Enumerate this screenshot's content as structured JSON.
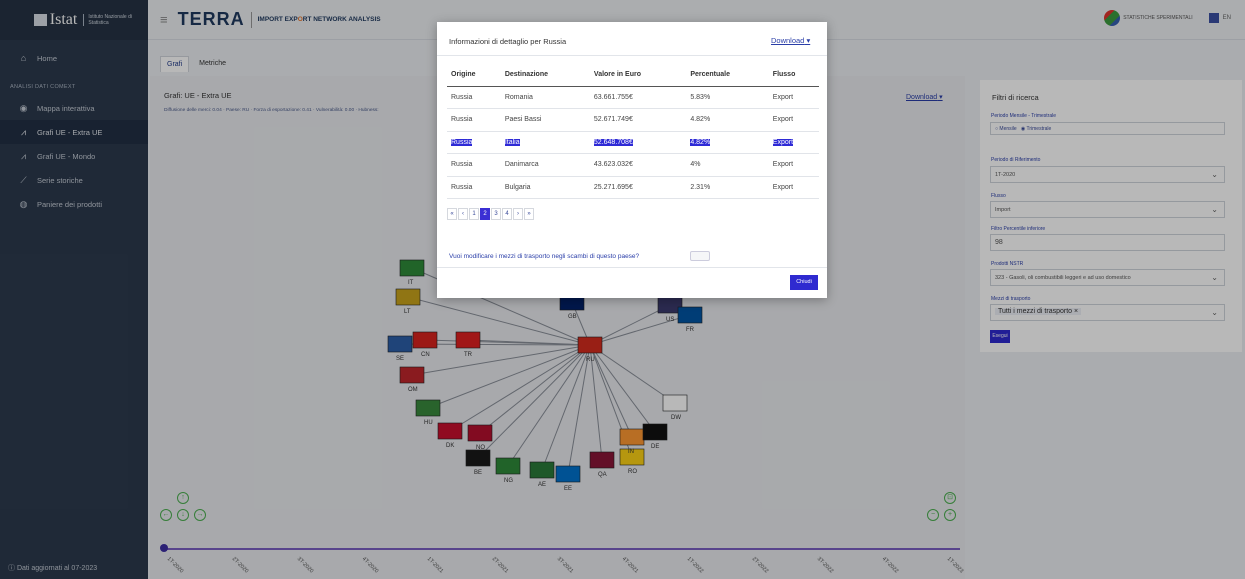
{
  "brand": {
    "name": "Istat",
    "sub": "Istituto Nazionale di Statistica"
  },
  "header": {
    "app_name": "TERRA",
    "tagline_a": "IMPORT EXP",
    "tagline_o": "O",
    "tagline_b": "RT NETWORK ANALYSIS",
    "stat_text": "STATISTICHE SPERIMENTALI",
    "lang": "EN"
  },
  "sidebar": {
    "home": "Home",
    "section": "ANALISI DATI COMEXT",
    "items": [
      "Mappa interattiva",
      "Grafi UE - Extra UE",
      "Grafi UE - Mondo",
      "Serie storiche",
      "Paniere dei prodotti"
    ],
    "footer": "Dati aggiornati al 07-2023"
  },
  "tabs": [
    "Grafi",
    "Metriche"
  ],
  "graph": {
    "title": "Grafi: UE - Extra UE",
    "meta": "Diffusione delle merci: 0.04 · Paese: RU · Forza di esportazione: 0.41 · Vulnerabilità: 0.00 · Hubness:",
    "download": "Download",
    "nodes": [
      "IT",
      "LT",
      "CN",
      "SE",
      "TR",
      "OM",
      "HU",
      "DK",
      "NO",
      "BE",
      "NG",
      "AE",
      "EE",
      "QA",
      "RO",
      "IN",
      "DE",
      "DW",
      "US",
      "FR",
      "GB",
      "RU"
    ],
    "timeline": [
      "1T-2020",
      "2T-2020",
      "3T-2020",
      "4T-2020",
      "1T-2021",
      "2T-2021",
      "3T-2021",
      "4T-2021",
      "1T-2022",
      "2T-2022",
      "3T-2022",
      "4T-2022",
      "1T-2023"
    ]
  },
  "filters": {
    "title": "Filtri di ricerca",
    "periodicity_label": "Periodo Mensile - Trimestrale",
    "radio_monthly": "Mensile",
    "radio_quarterly": "Trimestrale",
    "reference_label": "Periodo di Riferimento",
    "reference_value": "1T-2020",
    "flow_label": "Flusso",
    "flow_value": "Import",
    "percentile_label": "Filtro Percentile inferiore",
    "percentile_value": "98",
    "product_label": "Prodotti NSTR",
    "product_value": "323 - Gasoli, oli combustibili leggeri e ad uso domestico",
    "transport_label": "Mezzi di trasporto",
    "transport_value": "Tutti i mezzi di trasporto ×",
    "button": "Esegui"
  },
  "modal": {
    "title": "Informazioni di dettaglio per Russia",
    "download": "Download",
    "columns": [
      "Origine",
      "Destinazione",
      "Valore in Euro",
      "Percentuale",
      "Flusso"
    ],
    "rows": [
      [
        "Russia",
        "Romania",
        "63.661.755€",
        "5.83%",
        "Export"
      ],
      [
        "Russia",
        "Paesi Bassi",
        "52.671.749€",
        "4.82%",
        "Export"
      ],
      [
        "Russia",
        "Italia",
        "52.648.708€",
        "4.82%",
        "Export"
      ],
      [
        "Russia",
        "Danimarca",
        "43.623.032€",
        "4%",
        "Export"
      ],
      [
        "Russia",
        "Bulgaria",
        "25.271.695€",
        "2.31%",
        "Export"
      ]
    ],
    "highlighted_row": 2,
    "pager": [
      "«",
      "‹",
      "1",
      "2",
      "3",
      "4",
      "›",
      "»"
    ],
    "pager_active": "2",
    "question": "Vuoi modificare i mezzi di trasporto negli scambi di questo paese?",
    "close": "Chiudi"
  }
}
